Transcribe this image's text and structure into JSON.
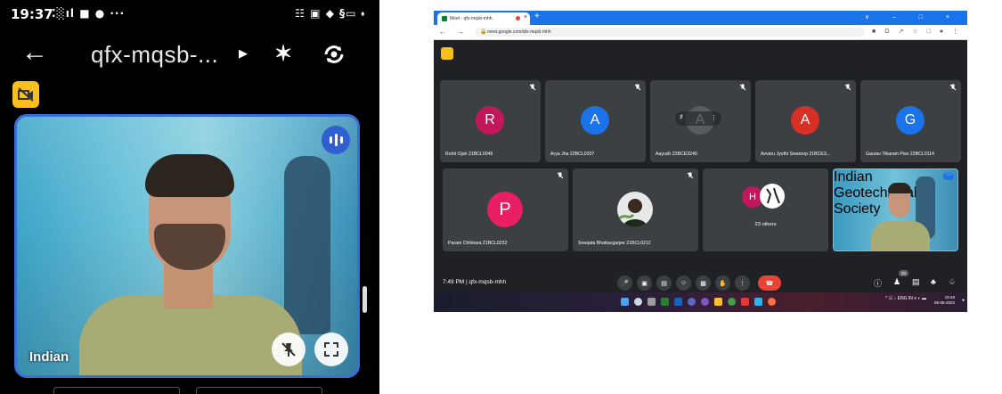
{
  "phone": {
    "status_time": "19:37",
    "status_left_icons": "⁚░ıl ■ ● ···",
    "status_right_icons": "☷ ▣ ◆ §▭ ⬪",
    "meeting_code": "qfx-mqsb-...",
    "tile_name": "Indian"
  },
  "desktop": {
    "tab_title": "Meet - qfx-mqsb-mhh",
    "tab_close": "×",
    "new_tab": "+",
    "window_controls": "∨ – □ ×",
    "nav_buttons": "← → C",
    "url": "meet.google.com/qfx-mqsb-mhh",
    "browser_icons": "■ G ↗ ☆ □ ● ⋮",
    "participants": [
      {
        "initial": "R",
        "name": "Rohit Ojah 21BCL0046",
        "color": "#c2185b"
      },
      {
        "initial": "A",
        "name": "Arya Jha 22BCL0107",
        "color": "#1a73e8"
      },
      {
        "initial": "A",
        "name": "Aayush 22BCE3240",
        "color": "#5f6368"
      },
      {
        "initial": "A",
        "name": "Avvaru Jyothi Swaroop 21BCE3...",
        "color": "#d93025"
      },
      {
        "initial": "G",
        "name": "Gaurav Tikaram Piso 22BCL0114",
        "color": "#1a73e8"
      },
      {
        "initial": "P",
        "name": "Param Chhikara 21BCL0232",
        "color": "#e91e63"
      },
      {
        "initial": "",
        "name": "Sreejata Bhattacgarjee 21BCL0212",
        "color": "#ffffff"
      }
    ],
    "others_initial": "H",
    "others_label": "23 others",
    "self_name": "Indian Geotechnical Society",
    "meeting_time": "7:49 PM",
    "meeting_separator": "|",
    "meeting_code": "qfx-mqsb-mhh",
    "participant_count": "33",
    "tray_text": "^ ☷ ↓ ENG IN ≡ ◐ ▬",
    "clock_time": "19:49",
    "clock_date": "05-06-2023"
  },
  "colors": {
    "meet_bg": "#202124",
    "tile_bg": "#3c4043",
    "chrome_blue": "#1a73e8",
    "leave_red": "#ea4335",
    "cam_off_yellow": "#f9bf1e",
    "phone_tile_border": "#3b6fd8"
  }
}
